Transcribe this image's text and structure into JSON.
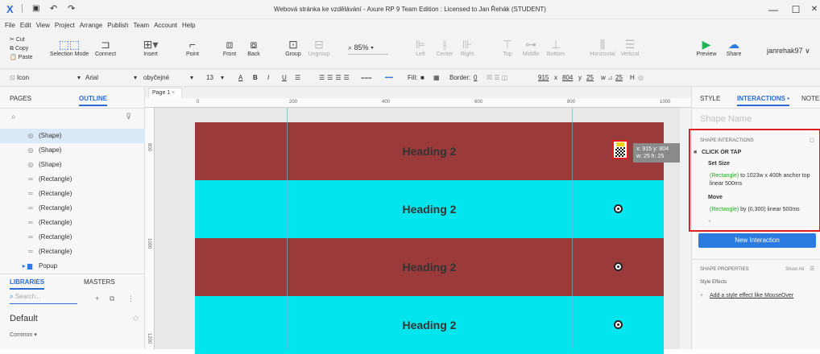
{
  "titlebar": {
    "title": "Webová stránka ke vzdělávání - Axure RP 9 Team Edition : Licensed to Jan Řehák (STUDENT)",
    "logo": "X",
    "minimize": "—",
    "maximize": "☐",
    "close": "✕"
  },
  "menu": [
    "File",
    "Edit",
    "View",
    "Project",
    "Arrange",
    "Publish",
    "Team",
    "Account",
    "Help"
  ],
  "toolbar": {
    "cut": "Cut",
    "copy": "Copy",
    "paste": "Paste",
    "selection_mode": "Selection Mode",
    "connect": "Connect",
    "insert": "Insert",
    "point": "Point",
    "front": "Front",
    "back": "Back",
    "group": "Group",
    "ungroup": "Ungroup",
    "zoom": "85%",
    "left": "Left",
    "center": "Center",
    "right": "Right",
    "top": "Top",
    "middle": "Middle",
    "bottom": "Bottom",
    "horizontal": "Horizontal",
    "vertical": "Vertical",
    "preview": "Preview",
    "share": "Share",
    "user": "janrehak97"
  },
  "stylebar": {
    "element_type": "Icon",
    "font": "Arial",
    "style": "obyčejné",
    "size": "13",
    "bold": "B",
    "italic": "I",
    "underline": "U",
    "fill_label": "Fill:",
    "border_label": "Border:",
    "border_value": "0",
    "x": "915",
    "y": "804",
    "w": "25",
    "h": "25",
    "x_label": "x",
    "y_label": "y",
    "w_label": "w",
    "h_label": "H"
  },
  "leftpanel": {
    "tab_pages": "PAGES",
    "tab_outline": "OUTLINE",
    "outline_items": [
      "(Shape)",
      "(Shape)",
      "(Shape)",
      "(Rectangle)",
      "(Rectangle)",
      "(Rectangle)",
      "(Rectangle)",
      "(Rectangle)",
      "(Rectangle)",
      "Popup"
    ],
    "tab_libraries": "LIBRARIES",
    "tab_masters": "MASTERS",
    "search_placeholder": "Search...",
    "library": "Default",
    "common": "Common ▾"
  },
  "canvas": {
    "page_tab": "Page 1",
    "ruler_h": [
      "0",
      "200",
      "400",
      "600",
      "800",
      "1000"
    ],
    "ruler_v": [
      "800",
      "1000",
      "1200"
    ],
    "strips": [
      {
        "heading": "Heading 2",
        "color": "#9b3a3a"
      },
      {
        "heading": "Heading 2",
        "color": "#00e5ee"
      },
      {
        "heading": "Heading 2",
        "color": "#9b3a3a"
      },
      {
        "heading": "Heading 2",
        "color": "#00e5ee"
      }
    ],
    "tooltip_line1": "x: 915   y: 804",
    "tooltip_line2": "w: 25    h: 25"
  },
  "rightpanel": {
    "tab_style": "STYLE",
    "tab_interactions": "INTERACTIONS •",
    "tab_notes": "NOTES",
    "shape_name_placeholder": "Shape Name",
    "shape_interactions": "SHAPE INTERACTIONS",
    "event": "CLICK OR TAP",
    "action1": "Set Size",
    "action1_target": "(Rectangle)",
    "action1_detail": " to 1023w x 400h anchor top linear 500ms",
    "action2": "Move",
    "action2_target": "(Rectangle)",
    "action2_detail": " by (0,300) linear 500ms",
    "new_interaction": "New Interaction",
    "shape_properties": "SHAPE PROPERTIES",
    "show_all": "Show All",
    "style_effects": "Style Effects",
    "add_effect": "Add a style effect like MouseOver"
  },
  "colors": {
    "accent": "#2b6cd4",
    "highlight": "#e02020",
    "button": "#2b7be0"
  }
}
